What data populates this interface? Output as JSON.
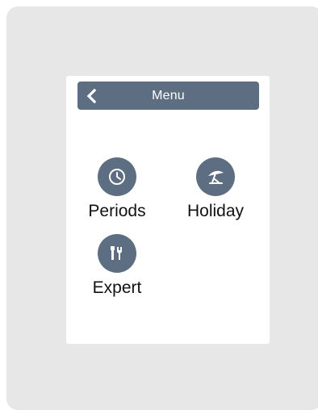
{
  "header": {
    "title": "Menu",
    "back_icon": "chevron-left-icon"
  },
  "menu": {
    "items": [
      {
        "label": "Periods",
        "icon": "clock-icon"
      },
      {
        "label": "Holiday",
        "icon": "beach-umbrella-icon"
      },
      {
        "label": "Expert",
        "icon": "tools-icon"
      }
    ]
  },
  "colors": {
    "accent": "#5d6e82",
    "device_frame": "#e7e7e7",
    "screen": "#ffffff",
    "text": "#111111"
  }
}
